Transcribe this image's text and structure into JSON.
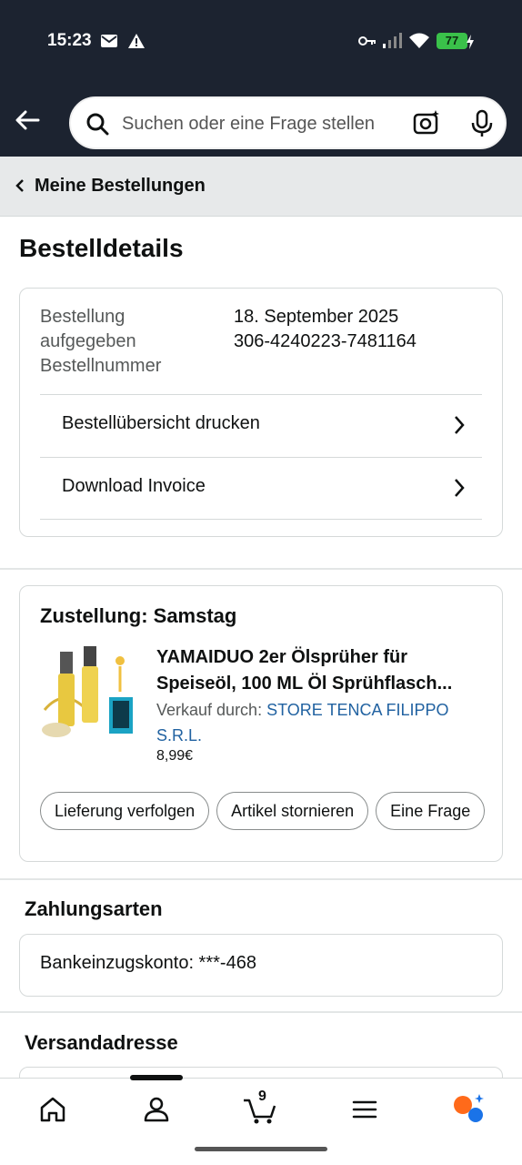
{
  "status": {
    "time": "15:23",
    "battery": "77"
  },
  "search": {
    "placeholder": "Suchen oder eine Frage stellen"
  },
  "breadcrumb": {
    "label": "Meine Bestellungen"
  },
  "page": {
    "title": "Bestelldetails"
  },
  "order": {
    "placed_label_1": "Bestellung",
    "placed_label_2": "aufgegeben",
    "number_label": "Bestellnummer",
    "placed_value": "18. September 2025",
    "number_value": "306-4240223-7481164"
  },
  "links": {
    "print": "Bestellübersicht drucken",
    "invoice": "Download Invoice"
  },
  "delivery": {
    "heading": "Zustellung: Samstag",
    "product_title_1": "YAMAIDUO 2er Ölsprüher für",
    "product_title_2": "Speiseöl, 100 ML Öl Sprühflasch...",
    "seller_prefix": "Verkauf durch:",
    "seller_name_1": "STORE TENCA FILIPPO",
    "seller_name_2": "S.R.L.",
    "price": "8,99€",
    "buttons": [
      "Lieferung verfolgen",
      "Artikel stornieren",
      "Eine Frage"
    ]
  },
  "payment": {
    "heading": "Zahlungsarten",
    "method": "Bankeinzugskonto: ***-468"
  },
  "shipping": {
    "heading": "Versandadresse"
  },
  "nav": {
    "cart_count": "9"
  },
  "colors": {
    "header_bg": "#1c2330",
    "link": "#2162a1",
    "battery": "#3ac14a"
  }
}
